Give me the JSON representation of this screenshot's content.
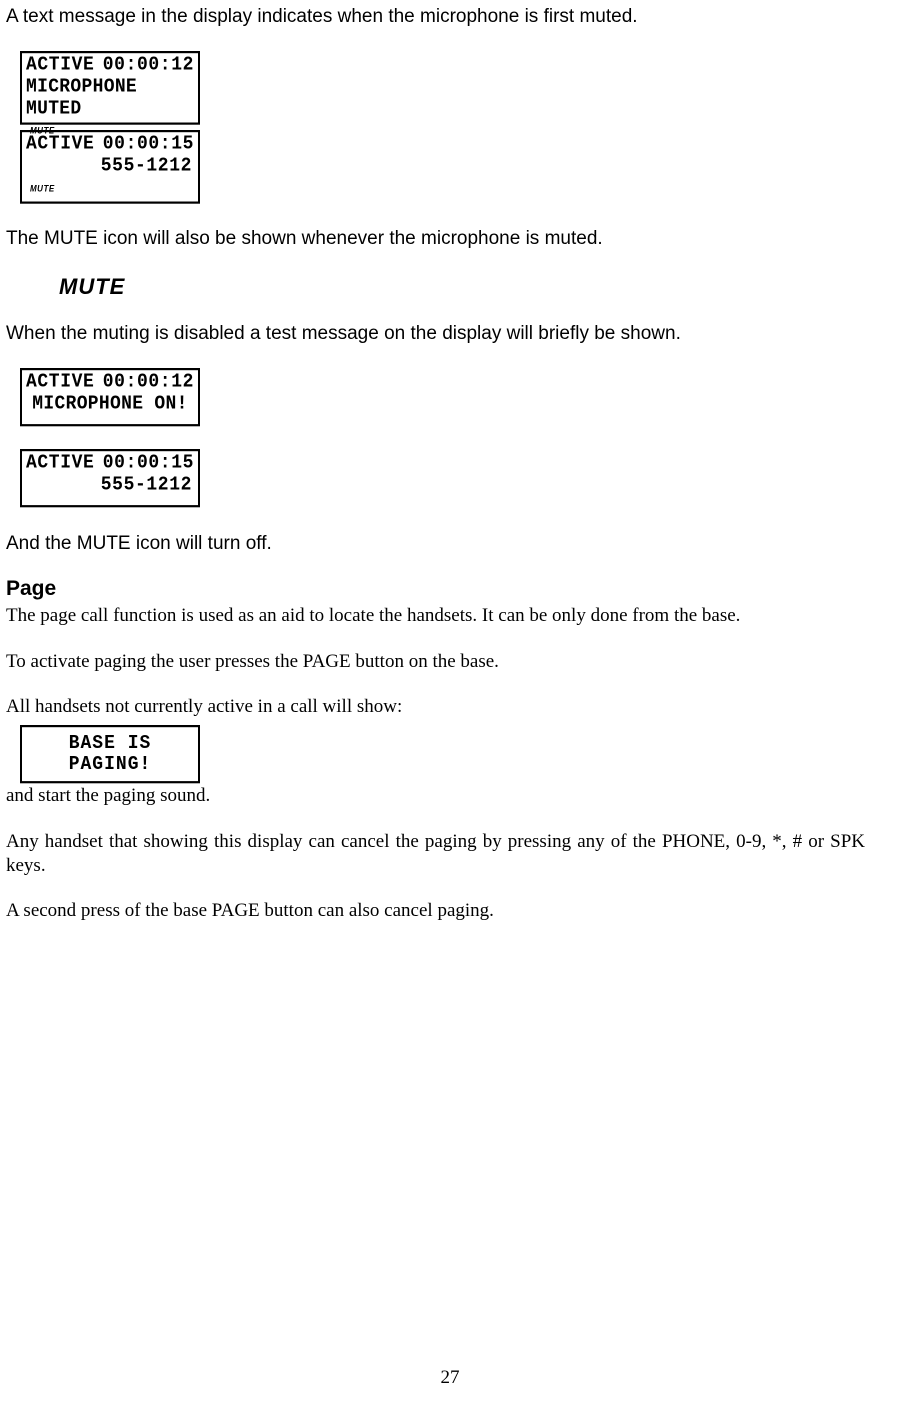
{
  "intro1": "A text message in the display indicates when the microphone is first muted.",
  "lcd1": {
    "status": "ACTIVE",
    "time": "00:00:12",
    "line2": "MICROPHONE MUTED",
    "badge": "MUTE"
  },
  "lcd2": {
    "status": "ACTIVE",
    "time": "00:00:15",
    "line2": "555-1212",
    "badge": "MUTE"
  },
  "afterLcd1": "The MUTE icon will also be shown whenever the microphone is muted.",
  "muteBig": "MUTE",
  "afterMuteBig": "When the muting is disabled a test message on the display will briefly be shown.",
  "lcd3": {
    "status": "ACTIVE",
    "time": "00:00:12",
    "line2": "MICROPHONE ON!"
  },
  "lcd4": {
    "status": "ACTIVE",
    "time": "00:00:15",
    "line2": "555-1212"
  },
  "afterLcd2": "And the MUTE icon will turn off.",
  "pageHeading": "Page",
  "pagePara1": "The page call function is used as an aid to locate the handsets.  It can be only done from the base.",
  "pagePara2": "To activate paging the user presses the PAGE button on the base.",
  "pagePara3": "All handsets not currently active in a call will show:",
  "lcd5": {
    "line1": "BASE IS",
    "line2": "PAGING!"
  },
  "pagePara4": "and start the paging sound.",
  "pagePara5": "Any handset that showing this display can cancel the paging by pressing any of the PHONE, 0-9, *, # or SPK keys.",
  "pagePara6": "A second press of the base PAGE button can also cancel paging.",
  "pageNumber": "27"
}
